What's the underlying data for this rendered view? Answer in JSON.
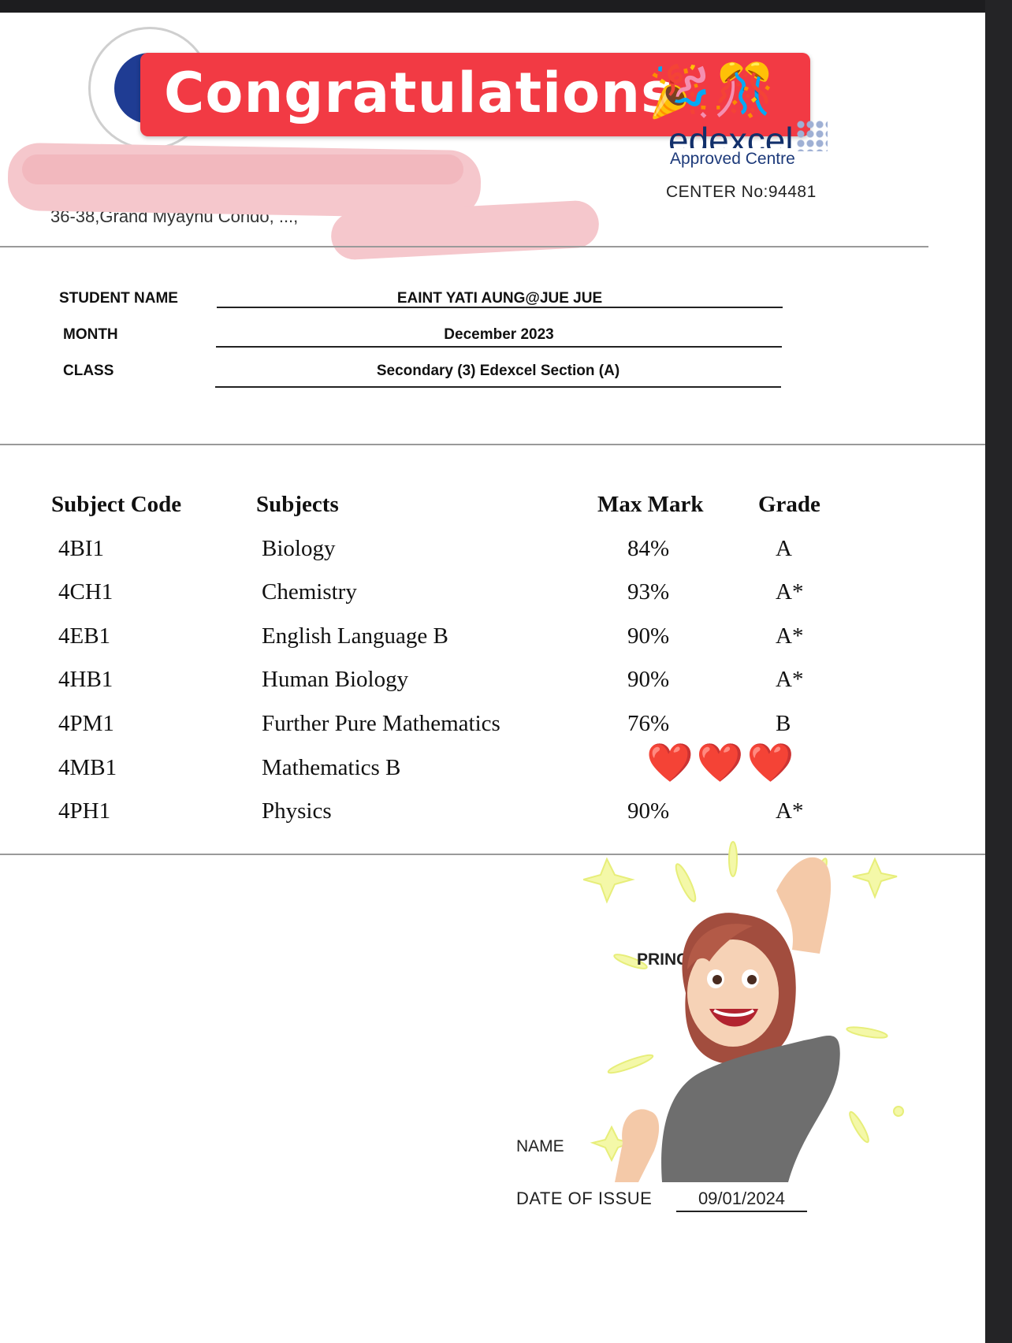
{
  "banner": {
    "text": "Congratulations",
    "emoji_party": "🎉",
    "emoji_gift": "🎊"
  },
  "centre": {
    "brand": "edexcel",
    "approved": "Approved Centre",
    "center_no": "CENTER No:94481"
  },
  "address": "36-38,Grand Myaynu Condo, ...,",
  "student": {
    "name_label": "STUDENT NAME",
    "name_value": "EAINT YATI AUNG@JUE JUE",
    "month_label": "MONTH",
    "month_value": "December 2023",
    "class_label": "CLASS",
    "class_value": "Secondary (3) Edexcel Section (A)"
  },
  "table": {
    "headers": {
      "code": "Subject Code",
      "subject": "Subjects",
      "max": "Max Mark",
      "grade": "Grade"
    },
    "rows": [
      {
        "code": "4BI1",
        "subject": "Biology",
        "max": "84%",
        "grade": "A"
      },
      {
        "code": "4CH1",
        "subject": "Chemistry",
        "max": "93%",
        "grade": "A*"
      },
      {
        "code": "4EB1",
        "subject": "English Language B",
        "max": "90%",
        "grade": "A*"
      },
      {
        "code": "4HB1",
        "subject": "Human Biology",
        "max": "90%",
        "grade": "A*"
      },
      {
        "code": "4PM1",
        "subject": "Further Pure Mathematics",
        "max": "76%",
        "grade": "B"
      },
      {
        "code": "4MB1",
        "subject": "Mathematics B",
        "max": "",
        "grade": ""
      },
      {
        "code": "4PH1",
        "subject": "Physics",
        "max": "90%",
        "grade": "A*"
      }
    ]
  },
  "stickers": {
    "hearts": "❤️❤️❤️"
  },
  "footer": {
    "principal": "PRINCIPAL",
    "name_label": "NAME",
    "doi_label": "DATE OF ISSUE",
    "doi_value": "09/01/2024"
  },
  "colors": {
    "banner": "#f23a44",
    "edexcel_blue": "#12306b"
  }
}
